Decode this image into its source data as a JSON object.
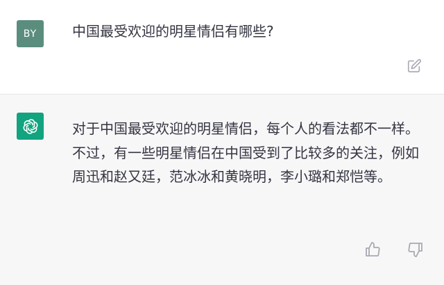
{
  "user_turn": {
    "avatar_initials": "BY",
    "avatar_color": "#5b8d7e",
    "message": "中国最受欢迎的明星情侣有哪些?",
    "action_icon": "edit-icon"
  },
  "assistant_turn": {
    "avatar_icon": "openai-logo-icon",
    "avatar_color": "#12a37f",
    "message": "对于中国最受欢迎的明星情侣，每个人的看法都不一样。不过，有一些明星情侣在中国受到了比较多的关注，例如周迅和赵又廷，范冰冰和黄晓明，李小璐和郑恺等。",
    "feedback_icons": [
      "thumbs-up-icon",
      "thumbs-down-icon"
    ]
  }
}
